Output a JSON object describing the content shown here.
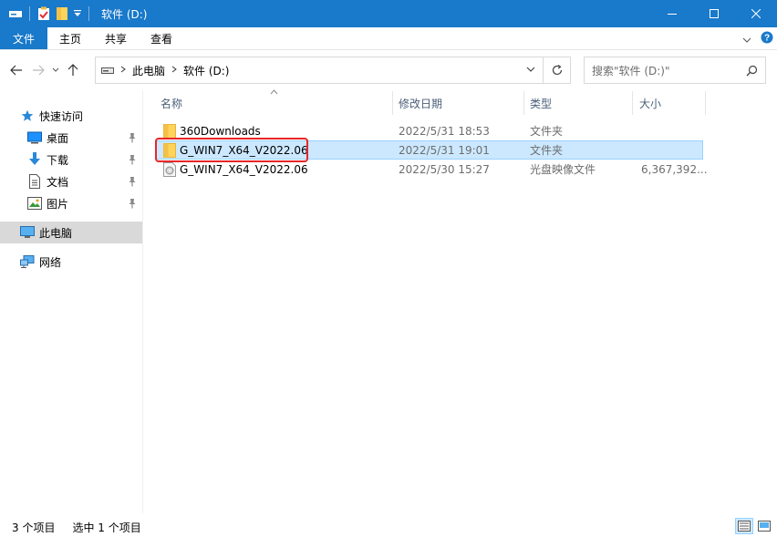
{
  "window": {
    "title": "软件 (D:)",
    "accent": "#1979ca"
  },
  "ribbon": {
    "tabs": [
      {
        "label": "文件"
      },
      {
        "label": "主页"
      },
      {
        "label": "共享"
      },
      {
        "label": "查看"
      }
    ]
  },
  "address": {
    "crumbs": [
      "此电脑",
      "软件 (D:)"
    ],
    "search_placeholder": "搜索\"软件 (D:)\""
  },
  "nav": {
    "items": [
      {
        "label": "快速访问",
        "icon": "star-icon"
      },
      {
        "label": "桌面",
        "icon": "desktop-icon",
        "pinned": true
      },
      {
        "label": "下载",
        "icon": "download-icon",
        "pinned": true
      },
      {
        "label": "文档",
        "icon": "document-icon",
        "pinned": true
      },
      {
        "label": "图片",
        "icon": "pictures-icon",
        "pinned": true
      },
      {
        "label": "此电脑",
        "icon": "computer-icon",
        "selected": true
      },
      {
        "label": "网络",
        "icon": "network-icon"
      }
    ]
  },
  "columns": {
    "name": "名称",
    "date": "修改日期",
    "type": "类型",
    "size": "大小"
  },
  "files": [
    {
      "name": "360Downloads",
      "date": "2022/5/31 18:53",
      "type": "文件夹",
      "size": "",
      "icon": "folder-icon"
    },
    {
      "name": "G_WIN7_X64_V2022.06",
      "date": "2022/5/31 19:01",
      "type": "文件夹",
      "size": "",
      "icon": "folder-icon",
      "selected": true
    },
    {
      "name": "G_WIN7_X64_V2022.06",
      "date": "2022/5/30 15:27",
      "type": "光盘映像文件",
      "size": "6,367,392...",
      "icon": "disc-image-icon"
    }
  ],
  "status": {
    "count": "3 个项目",
    "selection": "选中 1 个项目"
  }
}
